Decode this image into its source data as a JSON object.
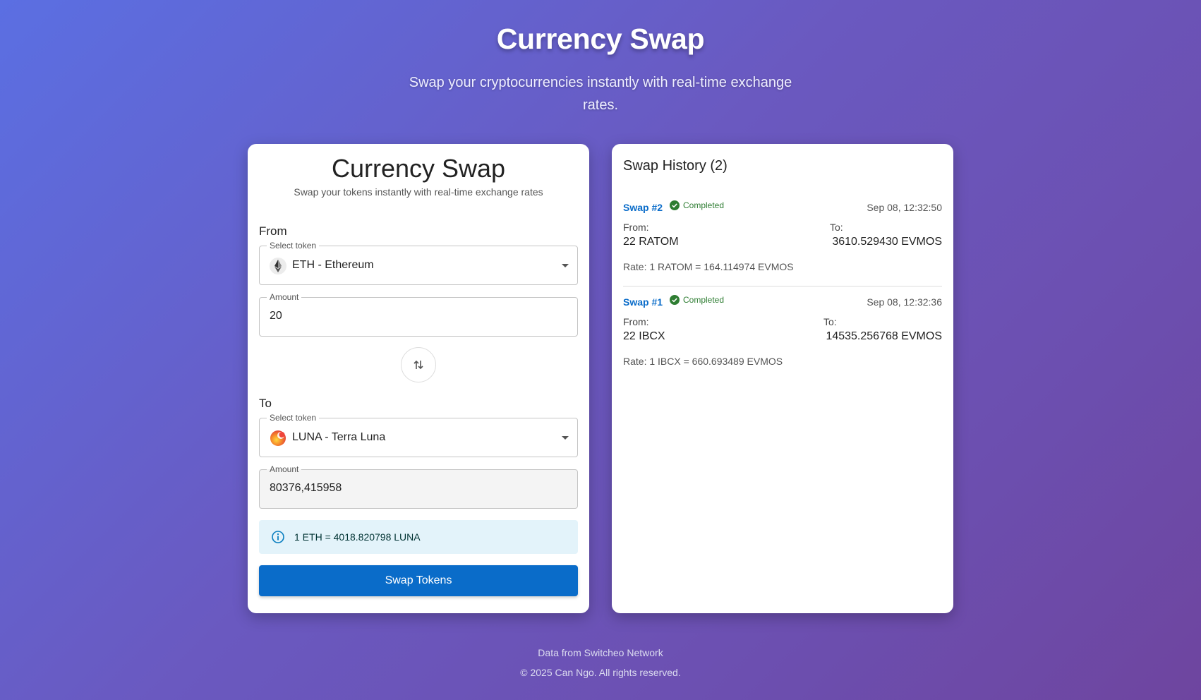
{
  "header": {
    "title": "Currency Swap",
    "subtitle": "Swap your cryptocurrencies instantly with real-time exchange rates."
  },
  "swap_form": {
    "title": "Currency Swap",
    "subtitle": "Swap your tokens instantly with real-time exchange rates",
    "from": {
      "section_label": "From",
      "token_legend": "Select token",
      "token": "ETH - Ethereum",
      "token_icon": "ethereum-icon",
      "amount_legend": "Amount",
      "amount": "20"
    },
    "to": {
      "section_label": "To",
      "token_legend": "Select token",
      "token": "LUNA - Terra Luna",
      "token_icon": "terra-luna-icon",
      "amount_legend": "Amount",
      "amount": "80376,415958"
    },
    "rate_info": "1 ETH = 4018.820798 LUNA",
    "submit_label": "Swap Tokens"
  },
  "history": {
    "title": "Swap History (2)",
    "items": [
      {
        "id": "Swap #2",
        "status": "Completed",
        "time": "Sep 08, 12:32:50",
        "from_label": "From:",
        "from": "22 RATOM",
        "to_label": "To:",
        "to": "3610.529430 EVMOS",
        "rate": "Rate: 1 RATOM = 164.114974 EVMOS"
      },
      {
        "id": "Swap #1",
        "status": "Completed",
        "time": "Sep 08, 12:32:36",
        "from_label": "From:",
        "from": "22 IBCX",
        "to_label": "To:",
        "to": "14535.256768 EVMOS",
        "rate": "Rate: 1 IBCX = 660.693489 EVMOS"
      }
    ]
  },
  "footer": {
    "source": "Data from Switcheo Network",
    "copyright": "© 2025 Can Ngo. All rights reserved."
  },
  "colors": {
    "accent": "#0a6cc9",
    "success": "#2e7d32",
    "info_background": "#e3f3fa"
  }
}
